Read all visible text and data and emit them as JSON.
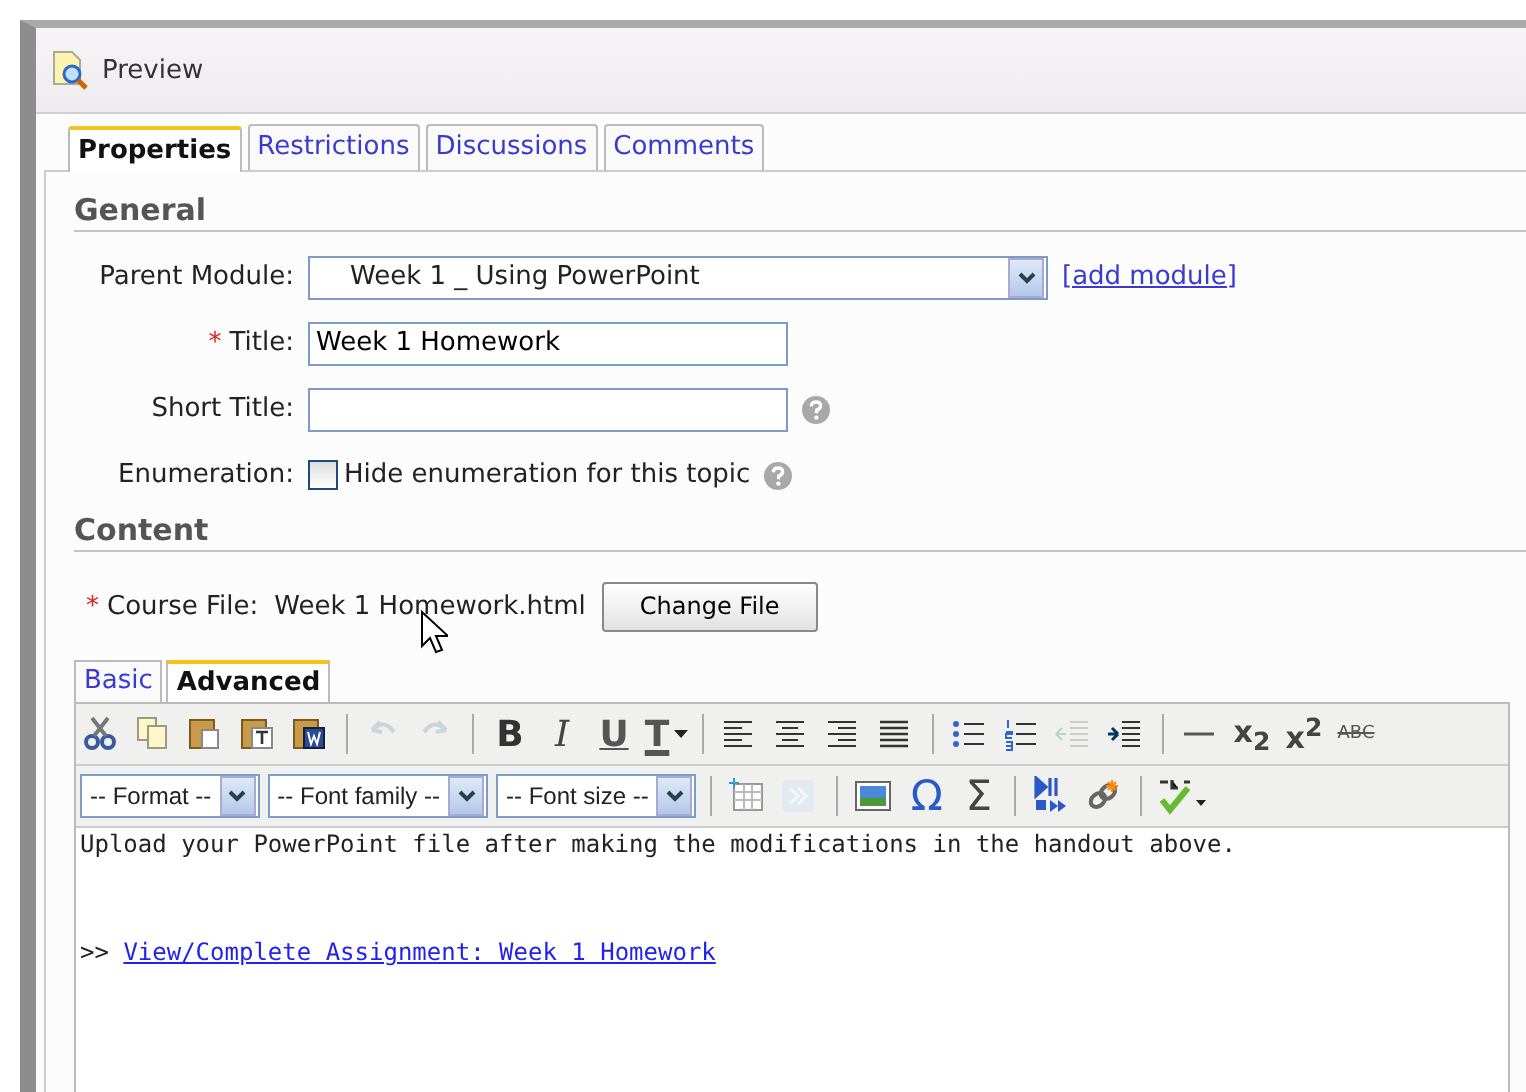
{
  "window": {
    "title": "Preview"
  },
  "tabs": [
    {
      "label": "Properties",
      "selected": true
    },
    {
      "label": "Restrictions",
      "selected": false
    },
    {
      "label": "Discussions",
      "selected": false
    },
    {
      "label": "Comments",
      "selected": false
    }
  ],
  "general": {
    "heading": "General",
    "parent_module": {
      "label": "Parent Module:",
      "value": "Week 1 _ Using PowerPoint",
      "link": "[add module]"
    },
    "title": {
      "label": "Title:",
      "required_mark": "*",
      "value": "Week 1 Homework"
    },
    "short_title": {
      "label": "Short Title:"
    },
    "enumeration": {
      "label": "Enumeration:",
      "checkbox_label": "Hide enumeration for this topic",
      "checked": false
    }
  },
  "content": {
    "heading": "Content",
    "course_file": {
      "label": "Course File:",
      "required_mark": "*",
      "value": "Week 1 Homework.html",
      "button": "Change File"
    }
  },
  "editor": {
    "tabs": [
      {
        "label": "Basic",
        "selected": false
      },
      {
        "label": "Advanced",
        "selected": true
      }
    ],
    "toolbar_1": [
      {
        "kind": "cut",
        "disabled": false
      },
      {
        "kind": "copy",
        "disabled": false
      },
      {
        "kind": "paste",
        "disabled": false
      },
      {
        "kind": "paste-text",
        "disabled": false
      },
      {
        "kind": "paste-word",
        "disabled": false
      },
      {
        "kind": "separator"
      },
      {
        "kind": "undo",
        "disabled": true
      },
      {
        "kind": "redo",
        "disabled": true
      },
      {
        "kind": "separator"
      },
      {
        "kind": "bold",
        "label": "B",
        "disabled": false
      },
      {
        "kind": "italic",
        "label": "I",
        "disabled": false
      },
      {
        "kind": "underline",
        "label": "U",
        "disabled": false
      },
      {
        "kind": "text-color",
        "label": "T",
        "disabled": false
      },
      {
        "kind": "separator"
      },
      {
        "kind": "align-left",
        "disabled": false
      },
      {
        "kind": "align-center",
        "disabled": false
      },
      {
        "kind": "align-right",
        "disabled": false
      },
      {
        "kind": "justify",
        "disabled": false
      },
      {
        "kind": "separator"
      },
      {
        "kind": "bullets",
        "disabled": false
      },
      {
        "kind": "numbers",
        "disabled": false
      },
      {
        "kind": "outdent",
        "disabled": true
      },
      {
        "kind": "indent",
        "disabled": false
      },
      {
        "kind": "separator"
      },
      {
        "kind": "rule",
        "disabled": false
      },
      {
        "kind": "subscript",
        "label": "x$_{2}$",
        "disabled": false
      },
      {
        "kind": "superscript",
        "label": "x$^{2}$",
        "disabled": false
      },
      {
        "kind": "strikethrough",
        "label": "ABC",
        "disabled": false
      }
    ],
    "toolbar_2": [
      {
        "kind": "select",
        "label": "-- Format --"
      },
      {
        "kind": "select",
        "label": "-- Font family --"
      },
      {
        "kind": "select",
        "label": "-- Font size --"
      },
      {
        "kind": "separator"
      },
      {
        "kind": "table",
        "disabled": false
      },
      {
        "kind": "forward",
        "disabled": true
      },
      {
        "kind": "separator"
      },
      {
        "kind": "image",
        "disabled": false
      },
      {
        "kind": "symbol",
        "label": "Ω",
        "disabled": false
      },
      {
        "kind": "equation",
        "label": "Σ",
        "disabled": false
      },
      {
        "kind": "separator"
      },
      {
        "kind": "media",
        "disabled": false
      },
      {
        "kind": "link",
        "disabled": false
      },
      {
        "kind": "separator"
      },
      {
        "kind": "spellcheck",
        "disabled": false
      }
    ],
    "body": [
      {
        "kind": "text",
        "text": "Upload your PowerPoint file after making the modifications in the handout above."
      },
      {
        "kind": "link",
        "prefix": ">>",
        "text": "View/Complete Assignment: Week 1 Homework"
      }
    ]
  }
}
